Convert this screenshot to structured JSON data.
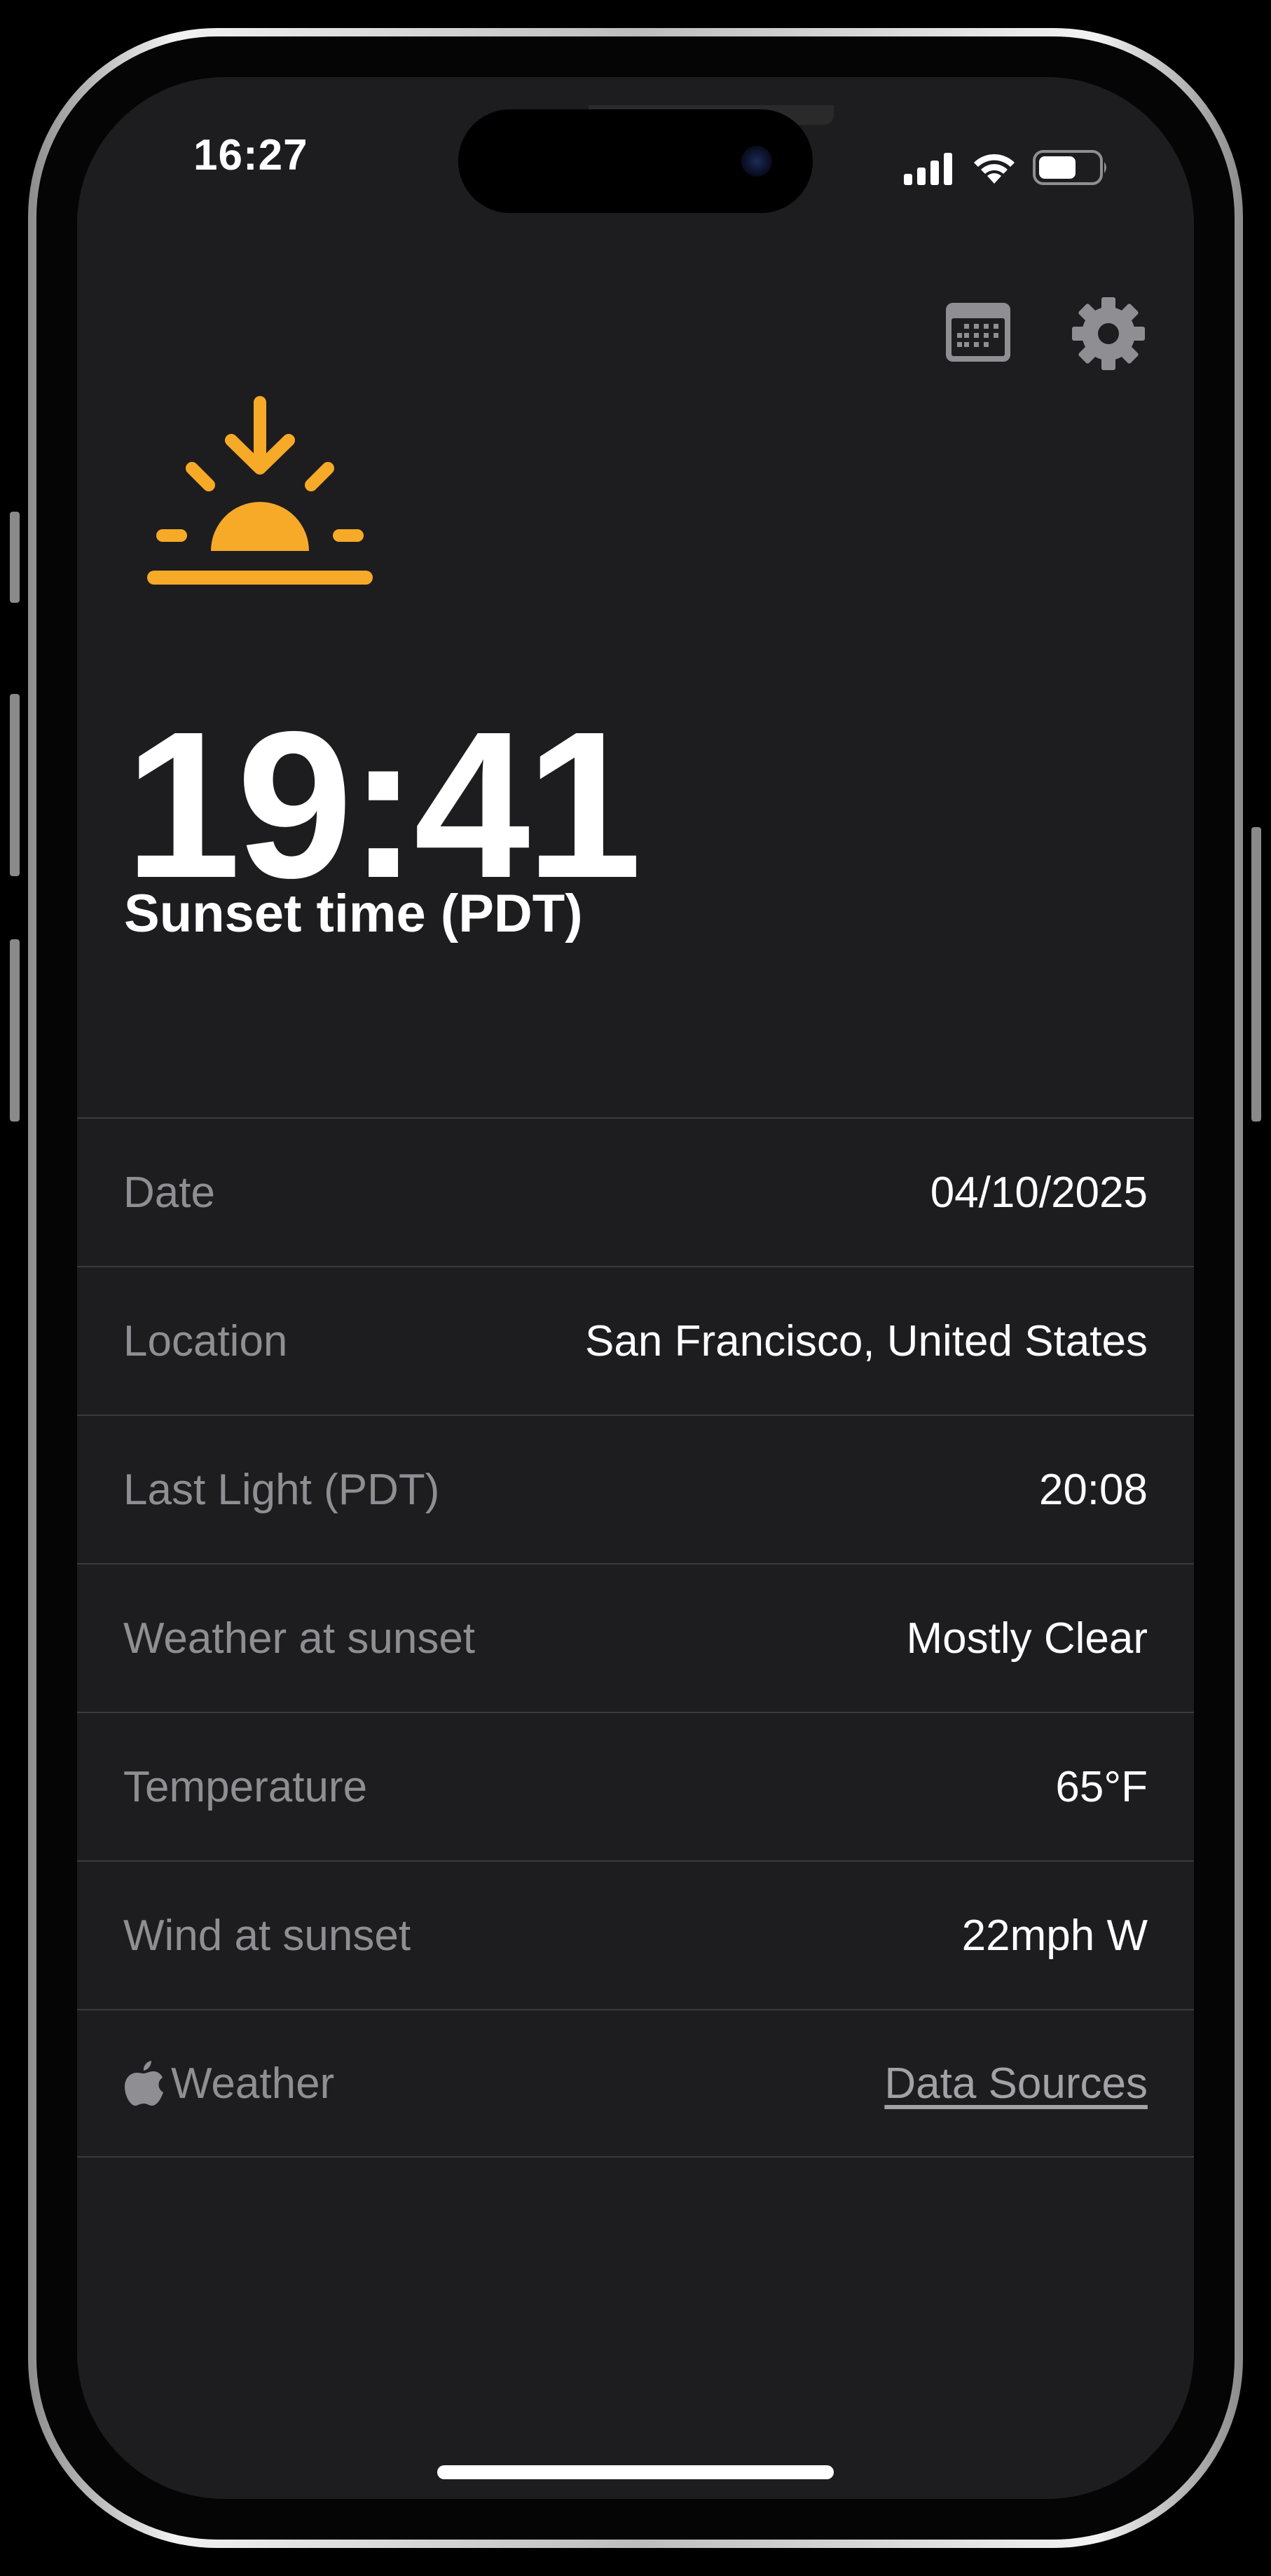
{
  "status_bar": {
    "time": "16:27",
    "icons": [
      "cellular-signal-icon",
      "wifi-icon",
      "battery-icon"
    ]
  },
  "toolbar": {
    "icons": [
      "calendar-icon",
      "gear-icon"
    ]
  },
  "hero": {
    "icon": "sunset-icon",
    "icon_color": "#F7A928",
    "time": "19:41",
    "label": "Sunset time (PDT)"
  },
  "details": {
    "rows": [
      {
        "label": "Date",
        "value": "04/10/2025"
      },
      {
        "label": "Location",
        "value": "San Francisco, United States"
      },
      {
        "label": "Last Light (PDT)",
        "value": "20:08"
      },
      {
        "label": "Weather at sunset",
        "value": "Mostly Clear"
      },
      {
        "label": "Temperature",
        "value": "65°F"
      },
      {
        "label": "Wind at sunset",
        "value": "22mph W"
      }
    ],
    "attribution": {
      "icon": "apple-logo-icon",
      "label": "Weather",
      "link": "Data Sources"
    }
  },
  "colors": {
    "background": "#1D1D1F",
    "accent": "#F7A928",
    "secondary_text": "#8E8E93",
    "divider": "#3A3A3C"
  }
}
